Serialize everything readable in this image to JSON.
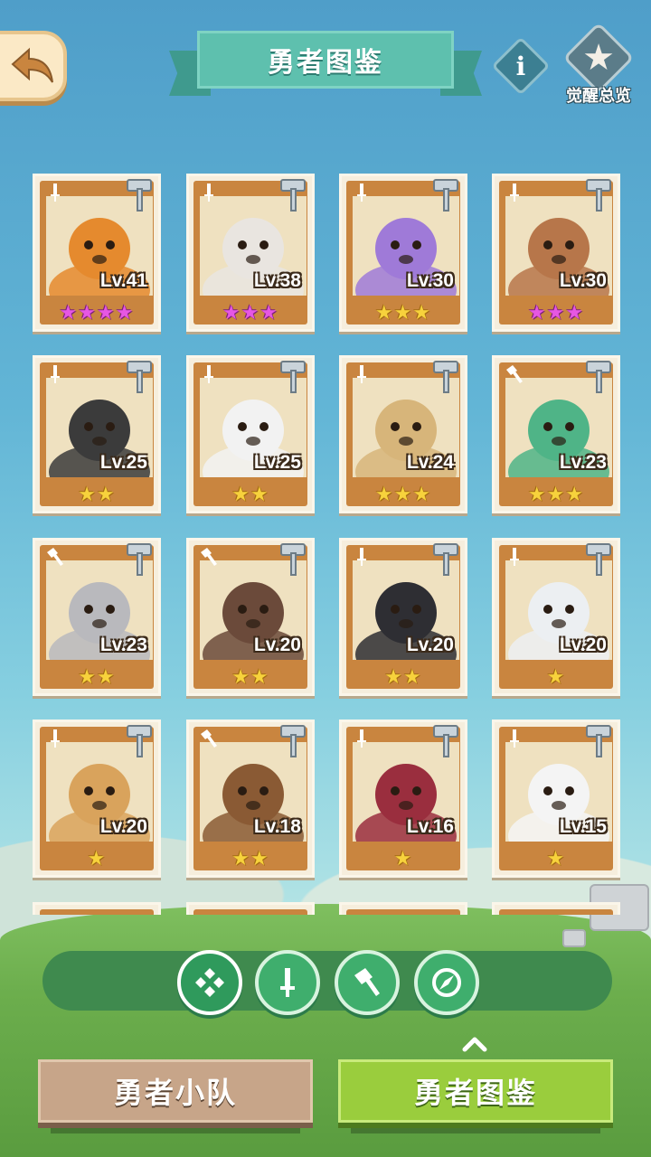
{
  "header": {
    "title": "勇者图鉴",
    "info_label": "i",
    "awaken_label": "觉醒总览"
  },
  "heroes": [
    {
      "level": "Lv.41",
      "stars": "★★★★",
      "star_color": "purple",
      "class_icon": "sword",
      "color": "#e58a2e"
    },
    {
      "level": "Lv.38",
      "stars": "★★★",
      "star_color": "purple",
      "class_icon": "sword",
      "color": "#e9e5e0"
    },
    {
      "level": "Lv.30",
      "stars": "★★★",
      "star_color": "gold",
      "class_icon": "sword",
      "color": "#9f7ad8"
    },
    {
      "level": "Lv.30",
      "stars": "★★★",
      "star_color": "purple",
      "class_icon": "sword",
      "color": "#b7764a"
    },
    {
      "level": "Lv.25",
      "stars": "★★",
      "star_color": "gold",
      "class_icon": "sword",
      "color": "#3b3b3b"
    },
    {
      "level": "Lv.25",
      "stars": "★★",
      "star_color": "gold",
      "class_icon": "sword",
      "color": "#f2f2f2"
    },
    {
      "level": "Lv.24",
      "stars": "★★★",
      "star_color": "gold",
      "class_icon": "sword",
      "color": "#d7b57a"
    },
    {
      "level": "Lv.23",
      "stars": "★★★",
      "star_color": "gold",
      "class_icon": "hammer",
      "color": "#4fb487"
    },
    {
      "level": "Lv.23",
      "stars": "★★",
      "star_color": "gold",
      "class_icon": "hammer",
      "color": "#b9b9bd"
    },
    {
      "level": "Lv.20",
      "stars": "★★",
      "star_color": "gold",
      "class_icon": "hammer",
      "color": "#6b4a3a"
    },
    {
      "level": "Lv.20",
      "stars": "★★",
      "star_color": "gold",
      "class_icon": "sword",
      "color": "#2e2e33"
    },
    {
      "level": "Lv.20",
      "stars": "★",
      "star_color": "gold",
      "class_icon": "sword",
      "color": "#eceff2"
    },
    {
      "level": "Lv.20",
      "stars": "★",
      "star_color": "gold",
      "class_icon": "sword",
      "color": "#d9a35c"
    },
    {
      "level": "Lv.18",
      "stars": "★★",
      "star_color": "gold",
      "class_icon": "hammer",
      "color": "#8a5a34"
    },
    {
      "level": "Lv.16",
      "stars": "★",
      "star_color": "gold",
      "class_icon": "sword",
      "color": "#9a2e3e"
    },
    {
      "level": "Lv.15",
      "stars": "★",
      "star_color": "gold",
      "class_icon": "sword",
      "color": "#f4f4f4"
    }
  ],
  "filters": [
    {
      "name": "all",
      "active": true
    },
    {
      "name": "sword",
      "active": false
    },
    {
      "name": "hammer",
      "active": false
    },
    {
      "name": "compass",
      "active": false
    }
  ],
  "tabs": {
    "team": "勇者小队",
    "codex": "勇者图鉴"
  },
  "colors": {
    "card_bg": "#c9853f",
    "active_tab": "#9acd3d",
    "inactive_tab": "#c7a589",
    "title_ribbon": "#5ec0ae"
  }
}
